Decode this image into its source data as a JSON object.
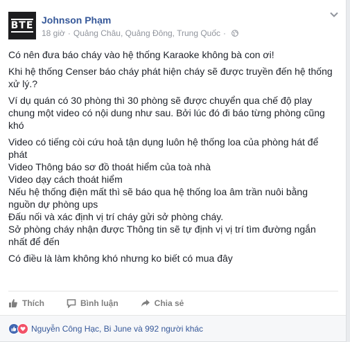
{
  "post": {
    "author": "Johnson Phạm",
    "avatar_text": "BTE",
    "time": "18 giờ",
    "separator": "·",
    "location": "Quảng Châu, Quảng Đông, Trung Quốc",
    "location_separator": "·",
    "paragraphs": [
      "Có nên đưa báo cháy vào hệ thống Karaoke không bà con ơi!",
      "Khi hệ thống Censer báo cháy phát hiện cháy sẽ được truyền đến hệ thống xử lý.?",
      "Ví dụ quán có 30 phòng thì 30 phòng sẽ được chuyển qua chế độ play chung một video có nội dung như sau. Bởi lúc đó đi báo từng phòng cũng khó"
    ],
    "list_lines": [
      "Video có tiếng còi cứu hoả tận dụng luôn hệ thống loa của phòng hát để phát",
      "Video Thông báo sơ đồ thoát hiểm của toà nhà",
      "Video dạy cách thoát hiểm",
      "Nếu hệ thống điện mất thì sẽ báo qua hệ thống loa âm trần nuôi bằng nguồn dự phòng ups",
      "Đấu nối và xác định vị trí cháy gửi sở phòng cháy.",
      "Sở phòng cháy nhận được Thông tin sẽ tự định vị vị trí tìm đường ngắn nhất để đến"
    ],
    "closing": "Có điều là làm không khó nhưng ko biết có mua đây"
  },
  "actions": {
    "like": "Thích",
    "comment": "Bình luận",
    "share": "Chia sẻ"
  },
  "reactions": {
    "text": "Nguyễn Công Hạc, Bi June và 992 người khác",
    "icons": [
      "like-icon",
      "love-icon"
    ]
  },
  "colors": {
    "link": "#365899",
    "meta": "#90949c",
    "like": "#4267b2",
    "love": "#f25268"
  }
}
